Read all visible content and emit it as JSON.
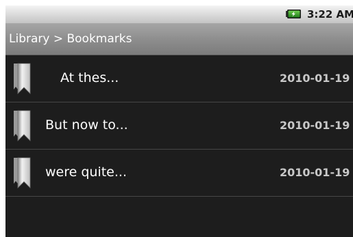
{
  "status_bar": {
    "time": "3:22 AM",
    "battery_icon": "battery-charging-icon",
    "battery_color": "#2e7d32"
  },
  "header": {
    "title": "Library > Bookmarks"
  },
  "bookmarks": [
    {
      "text": "At thes...",
      "date": "2010-01-19",
      "icon": "bookmark-icon"
    },
    {
      "text": "But now to...",
      "date": "2010-01-19",
      "icon": "bookmark-icon"
    },
    {
      "text": "were quite...",
      "date": "2010-01-19",
      "icon": "bookmark-icon"
    }
  ]
}
